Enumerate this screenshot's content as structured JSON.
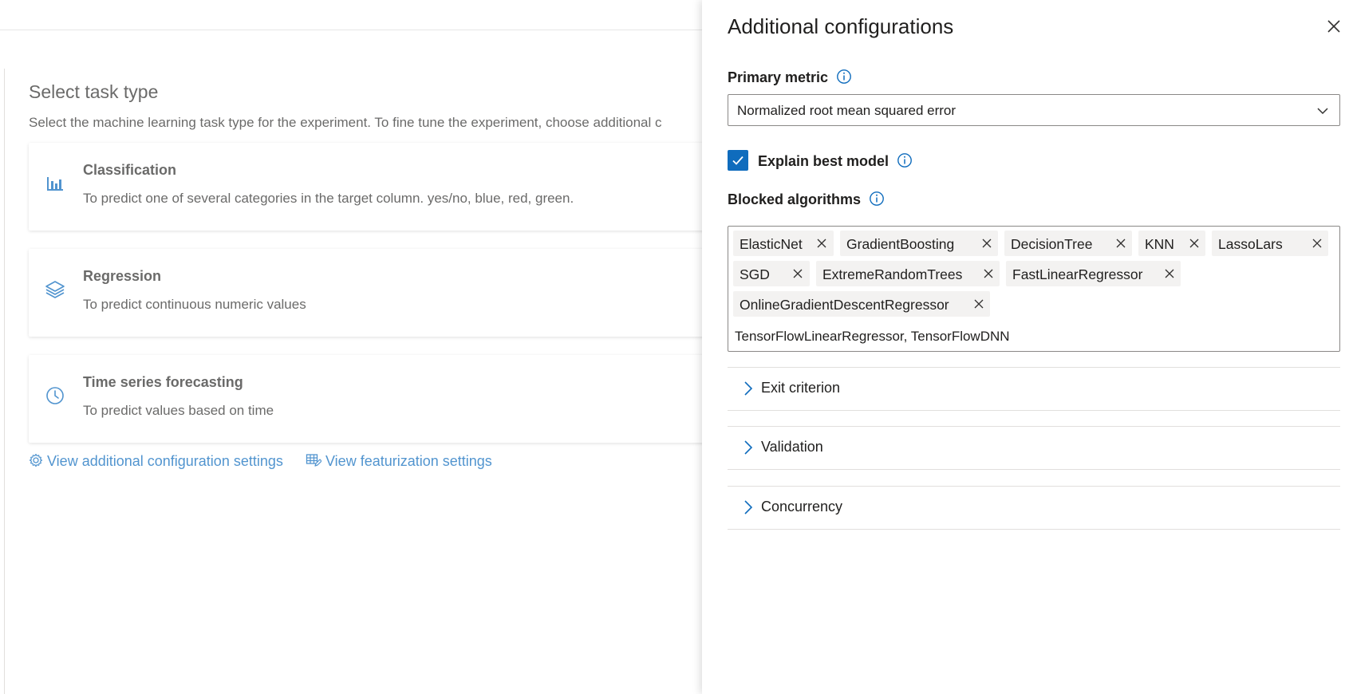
{
  "background": {
    "section_title": "Select task type",
    "section_description": "Select the machine learning task type for the experiment. To fine tune the experiment, choose additional c",
    "tasks": [
      {
        "title": "Classification",
        "description": "To predict one of several categories in the target column. yes/no, blue, red, green.",
        "icon": "bar-chart-icon"
      },
      {
        "title": "Regression",
        "description": "To predict continuous numeric values",
        "icon": "layers-icon"
      },
      {
        "title": "Time series forecasting",
        "description": "To predict values based on time",
        "icon": "clock-icon"
      }
    ],
    "links": {
      "additional_config": "View additional configuration settings",
      "featurization": "View featurization settings"
    }
  },
  "panel": {
    "title": "Additional configurations",
    "primary_metric": {
      "label": "Primary metric",
      "value": "Normalized root mean squared error"
    },
    "explain_best_model": {
      "label": "Explain best model",
      "checked": true
    },
    "blocked_algorithms": {
      "label": "Blocked algorithms",
      "tags": [
        "ElasticNet",
        "GradientBoosting",
        "DecisionTree",
        "KNN",
        "LassoLars",
        "SGD",
        "ExtremeRandomTrees",
        "FastLinearRegressor",
        "OnlineGradientDescentRegressor"
      ],
      "input_text": "TensorFlowLinearRegressor, TensorFlowDNN"
    },
    "sections": [
      "Exit criterion",
      "Validation",
      "Concurrency"
    ]
  },
  "colors": {
    "accent": "#0f6cbd",
    "tag_background": "#f3f2f1",
    "border": "#8a8886"
  }
}
